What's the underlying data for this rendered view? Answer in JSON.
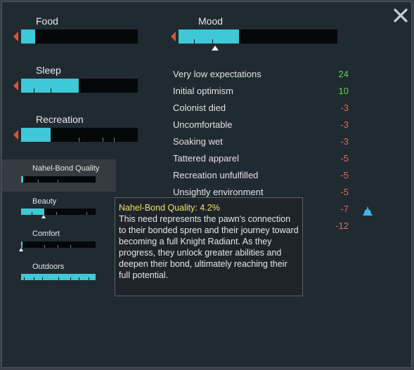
{
  "window": {
    "close_label": "×"
  },
  "needs_top": {
    "food": {
      "label": "Food",
      "value": 0.12
    },
    "sleep": {
      "label": "Sleep",
      "value": 0.49
    },
    "recreation": {
      "label": "Recreation",
      "value": 0.25
    },
    "mood": {
      "label": "Mood",
      "value": 0.38
    }
  },
  "needs_small": {
    "bond": {
      "label": "Nahel-Bond Quality",
      "value": 0.042
    },
    "beauty": {
      "label": "Beauty",
      "value": 0.31
    },
    "comfort": {
      "label": "Comfort",
      "value": 0.02
    },
    "outdoors": {
      "label": "Outdoors",
      "value": 1.0
    }
  },
  "thoughts": [
    {
      "label": "Very low expectations",
      "value": "24"
    },
    {
      "label": "Initial optimism",
      "value": "10"
    },
    {
      "label": "Colonist died",
      "value": "-3"
    },
    {
      "label": "Uncomfortable",
      "value": "-3"
    },
    {
      "label": "Soaking wet",
      "value": "-3"
    },
    {
      "label": "Tattered apparel",
      "value": "-5"
    },
    {
      "label": "Recreation unfulfilled",
      "value": "-5"
    },
    {
      "label": "Unsightly environment",
      "value": "-5"
    },
    {
      "label": "",
      "value": "-7"
    },
    {
      "label": "",
      "value": "-12"
    }
  ],
  "tooltip": {
    "title": "Nahel-Bond Quality: 4.2%",
    "body": "This need represents the pawn's connection to their bonded spren and their journey toward becoming a full Knight Radiant. As they progress, they unlock greater abilities and deepen their bond, ultimately reaching their full potential."
  },
  "icons": {
    "close": "close-icon",
    "arrow": "arrow-left-icon",
    "bell": "bell-icon"
  },
  "colors": {
    "fill": "#3fc8d8",
    "positive": "#5bd65b",
    "negative": "#e06a5a",
    "tooltip_title": "#eee46a"
  }
}
